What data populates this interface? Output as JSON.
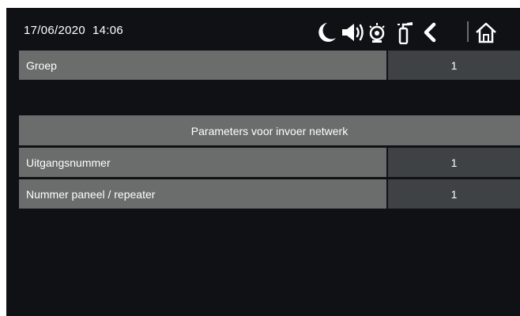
{
  "status_bar": {
    "datetime": "17/06/2020  14:06",
    "icons": [
      "moon-icon",
      "speaker-icon",
      "alarm-bell-icon",
      "fire-extinguisher-icon",
      "back-icon",
      "home-icon"
    ]
  },
  "rows": {
    "groep": {
      "label": "Groep",
      "value": "1"
    },
    "uitgangsnummer": {
      "label": "Uitgangsnummer",
      "value": "1"
    },
    "nummer_paneel": {
      "label": "Nummer paneel / repeater",
      "value": "1"
    }
  },
  "section": {
    "title": "Parameters voor invoer netwerk"
  },
  "colors": {
    "background": "#0f1114",
    "label_cell": "#6a6d6b",
    "value_cell": "#3f4245",
    "text": "#ffffff"
  }
}
